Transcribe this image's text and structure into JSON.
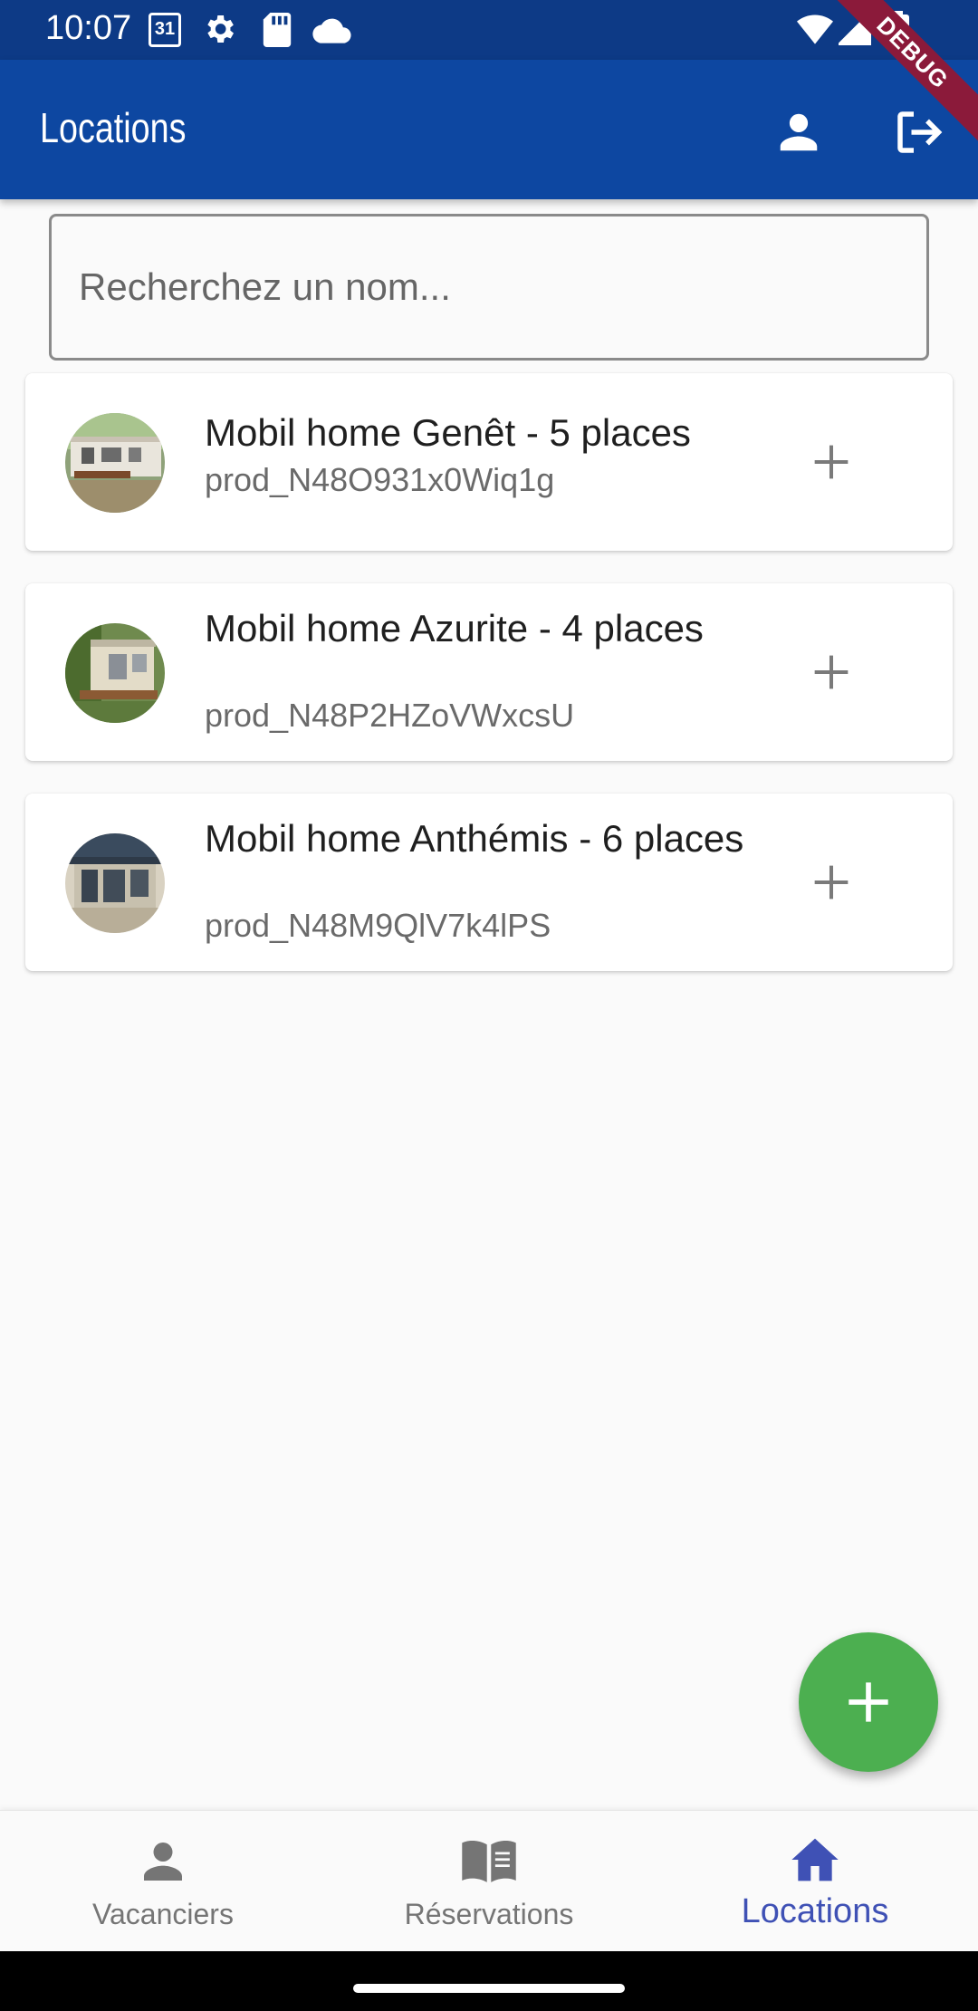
{
  "status_bar": {
    "time": "10:07",
    "calendar_day": "31",
    "icons": [
      "calendar-icon",
      "settings-icon",
      "sd-card-icon",
      "cloud-icon",
      "wifi-icon",
      "signal-icon",
      "battery-icon"
    ]
  },
  "debug_banner": "DEBUG",
  "app_bar": {
    "title": "Locations",
    "actions": [
      "person-icon",
      "logout-icon"
    ]
  },
  "search": {
    "placeholder": "Recherchez un nom...",
    "value": ""
  },
  "rentals": [
    {
      "name": "Mobil home Genêt - 5 places",
      "id": "prod_N48O931x0Wiq1g",
      "action_icon": "add-icon"
    },
    {
      "name": "Mobil home Azurite - 4 places",
      "id": "prod_N48P2HZoVWxcsU",
      "action_icon": "add-icon"
    },
    {
      "name": "Mobil home Anthémis - 6 places",
      "id": "prod_N48M9QlV7k4lPS",
      "action_icon": "add-icon"
    }
  ],
  "fab": {
    "icon": "add-icon",
    "color": "#4caf50"
  },
  "bottom_nav": {
    "items": [
      {
        "label": "Vacanciers",
        "icon": "person-icon",
        "active": false
      },
      {
        "label": "Réservations",
        "icon": "book-icon",
        "active": false
      },
      {
        "label": "Locations",
        "icon": "home-icon",
        "active": true
      }
    ],
    "active_color": "#3f51b5"
  },
  "colors": {
    "app_bar": "#0d47a1",
    "status_bar": "#0d3a86",
    "background": "#fafafa"
  }
}
